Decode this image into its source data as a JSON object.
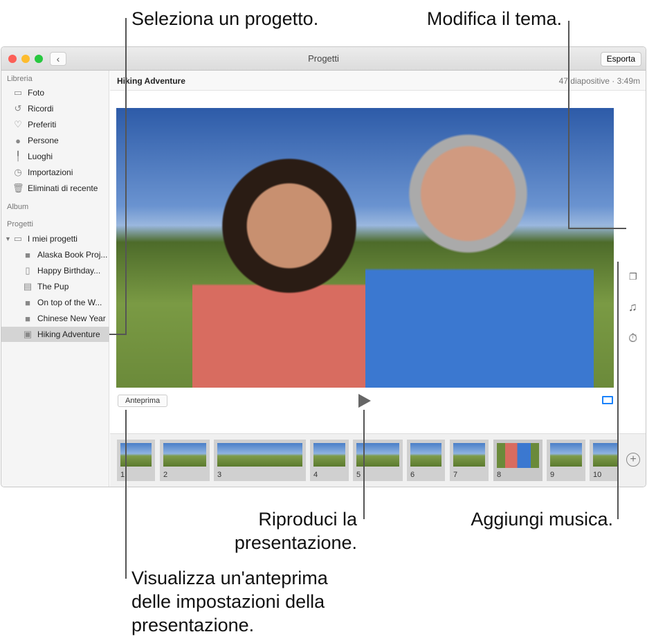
{
  "callouts": {
    "select_project": "Seleziona un progetto.",
    "change_theme": "Modifica il tema.",
    "play_1": "Riproduci la",
    "play_2": "presentazione.",
    "add_music": "Aggiungi musica.",
    "preview_1": "Visualizza un'anteprima",
    "preview_2": "delle impostazioni della",
    "preview_3": "presentazione."
  },
  "window": {
    "title": "Progetti",
    "export_label": "Esporta"
  },
  "sidebar": {
    "library_header": "Libreria",
    "library": [
      {
        "label": "Foto",
        "icon": "photos-icon"
      },
      {
        "label": "Ricordi",
        "icon": "memories-icon"
      },
      {
        "label": "Preferiti",
        "icon": "heart-icon"
      },
      {
        "label": "Persone",
        "icon": "person-icon"
      },
      {
        "label": "Luoghi",
        "icon": "pin-icon"
      },
      {
        "label": "Importazioni",
        "icon": "clock-icon"
      },
      {
        "label": "Eliminati di recente",
        "icon": "trash-icon"
      }
    ],
    "album_header": "Album",
    "projects_header": "Progetti",
    "folder": "I miei progetti",
    "projects": [
      "Alaska Book Proj...",
      "Happy Birthday...",
      "The Pup",
      "On top of the W...",
      "Chinese New Year",
      "Hiking Adventure"
    ],
    "selected": "Hiking Adventure"
  },
  "main": {
    "project_title": "Hiking Adventure",
    "info": "47 diapositive · 3:49m",
    "preview_label": "Anteprima",
    "thumbnails": [
      "1",
      "2",
      "3",
      "4",
      "5",
      "6",
      "7",
      "8",
      "9",
      "10"
    ],
    "selected_thumbnail": "8"
  },
  "colors": {
    "accent": "#1a82fb",
    "selected_row": "#d4d4d4"
  }
}
